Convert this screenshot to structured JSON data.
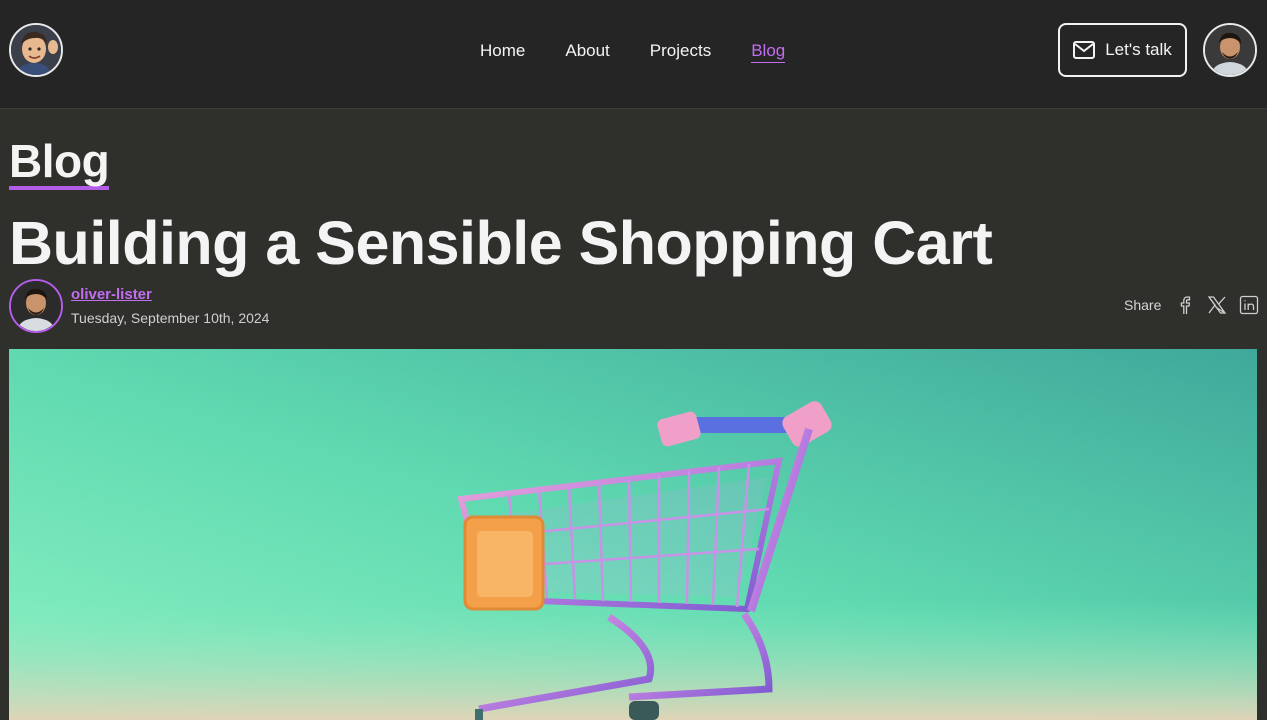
{
  "header": {
    "nav": [
      {
        "label": "Home"
      },
      {
        "label": "About"
      },
      {
        "label": "Projects"
      },
      {
        "label": "Blog",
        "active": true
      }
    ],
    "cta_label": "Let's talk",
    "cta_icon": "mail-icon"
  },
  "page": {
    "section_label": "Blog",
    "title": "Building a Sensible Shopping Cart"
  },
  "post": {
    "author": "oliver-lister",
    "date": "Tuesday, September 10th, 2024",
    "share_label": "Share",
    "share_icons": [
      "facebook-icon",
      "x-icon",
      "linkedin-icon"
    ]
  },
  "hero": {
    "alt_subject": "shopping-cart"
  },
  "colors": {
    "accent": "#b25ce8",
    "background": "#2f2f2c",
    "header_bg": "#252525",
    "hero_gradient_start": "#8cf2c3",
    "hero_gradient_end": "#3fa89b"
  }
}
